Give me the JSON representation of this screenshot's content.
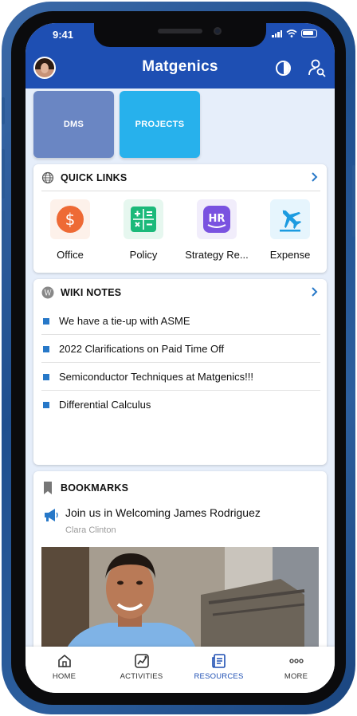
{
  "status_bar": {
    "time": "9:41"
  },
  "header": {
    "title": "Matgenics"
  },
  "tiles": [
    {
      "label": "DMS"
    },
    {
      "label": "PROJECTS"
    }
  ],
  "quick_links": {
    "title": "QUICK LINKS",
    "items": [
      {
        "label": "Office",
        "icon": "dollar-icon",
        "bg": "#fdf1ea",
        "color": "#ee6a35"
      },
      {
        "label": "Policy",
        "icon": "calculator-icon",
        "bg": "#e6f7ef",
        "color": "#1bb97a"
      },
      {
        "label": "Strategy Re...",
        "icon": "hr-icon",
        "icon_text": "HR",
        "bg": "#f1edfb",
        "color": "#7a52e0"
      },
      {
        "label": "Expense",
        "icon": "airplane-icon",
        "bg": "#e6f5fd",
        "color": "#1c9be0"
      }
    ]
  },
  "wiki_notes": {
    "title": "WIKI NOTES",
    "items": [
      {
        "label": "We have a tie-up with ASME"
      },
      {
        "label": "2022 Clarifications on Paid Time Off"
      },
      {
        "label": "Semiconductor Techniques at Matgenics!!!"
      },
      {
        "label": "Differential Calculus"
      }
    ]
  },
  "bookmarks": {
    "title": "BOOKMARKS",
    "post": {
      "title": "Join us in Welcoming James Rodriguez",
      "author": "Clara  Clinton"
    }
  },
  "tab_bar": {
    "active": "RESOURCES",
    "tabs": [
      {
        "label": "HOME",
        "icon": "home-icon"
      },
      {
        "label": "ACTIVITIES",
        "icon": "activities-icon"
      },
      {
        "label": "RESOURCES",
        "icon": "resources-icon"
      },
      {
        "label": "MORE",
        "icon": "more-icon"
      }
    ]
  },
  "colors": {
    "header": "#1e4fb3",
    "accent": "#2778c8",
    "tile_dms": "#6a86c3",
    "tile_projects": "#27b1ec"
  }
}
